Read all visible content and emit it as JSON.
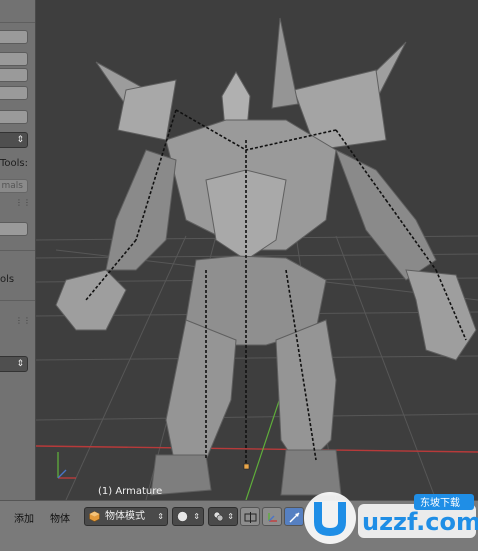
{
  "shelf": {
    "label_tools_1": "Tools:",
    "ghost_button": "mals",
    "label_tools_2": "ols",
    "dropdown_arrow": "⇕"
  },
  "viewport": {
    "label": "(1) Armature",
    "axis_x_color": "#c63c3c",
    "axis_y_color": "#5fae3b",
    "grid_color": "#5a5a5a",
    "mesh_color": "#8c8c8c"
  },
  "header": {
    "menu_add": "添加",
    "menu_object": "物体",
    "mode_dropdown": {
      "label": "物体模式",
      "icon": "cube-icon",
      "arrow": "⇕"
    },
    "shading_dropdown": {
      "icon": "sphere-icon",
      "arrow": "⇕"
    },
    "pivot_dropdown": {
      "icon": "pivot-icon",
      "arrow": "⇕"
    },
    "buttons": [
      "snap-icon",
      "manipulator-icon",
      "translate-icon"
    ]
  },
  "watermark": {
    "text": "uzzf.com",
    "badge": "东坡下载",
    "color": "#1f8ee6"
  }
}
